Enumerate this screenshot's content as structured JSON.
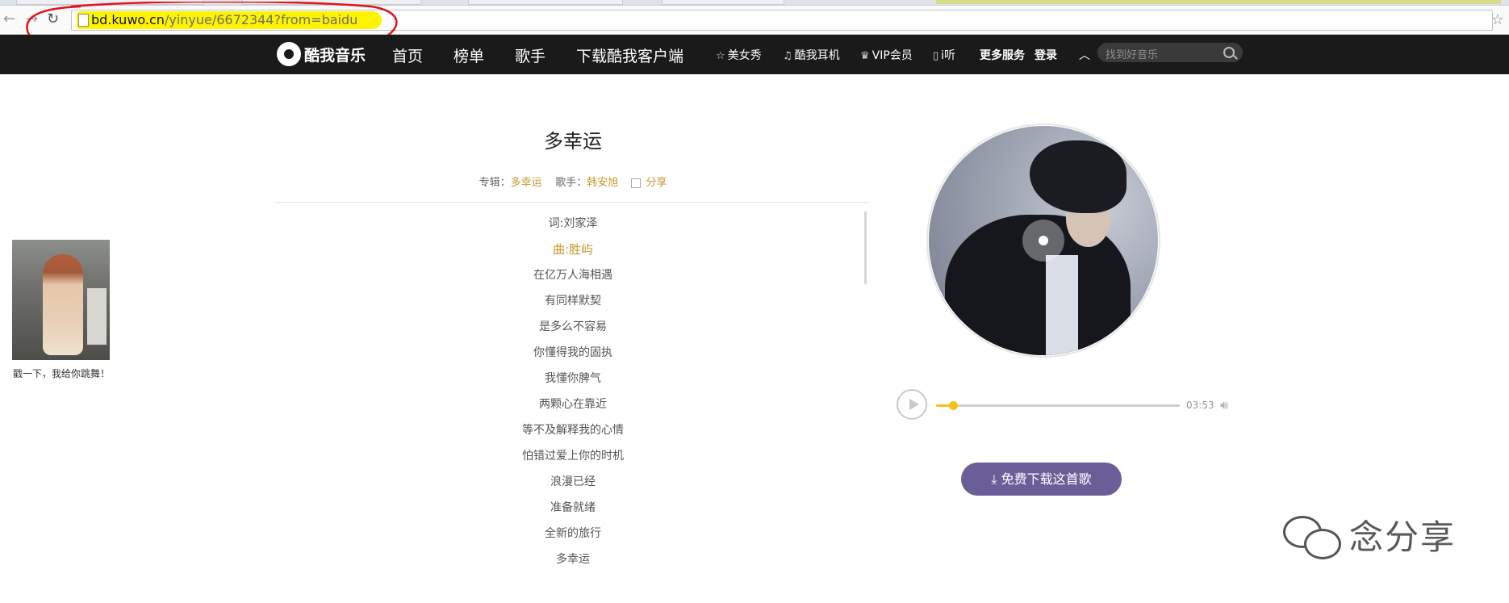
{
  "browser": {
    "url_host": "bd.kuwo.cn",
    "url_rest": "/yinyue/6672344?from=baidu"
  },
  "header": {
    "logo_text": "酷我音乐",
    "main_nav": [
      "首页",
      "榜单",
      "歌手",
      "下载酷我客户端"
    ],
    "sub_nav": [
      {
        "icon": "star-icon",
        "label": "美女秀"
      },
      {
        "icon": "headphones-icon",
        "label": "酷我耳机"
      },
      {
        "icon": "crown-icon",
        "label": "VIP会员"
      },
      {
        "icon": "book-icon",
        "label": "i听"
      }
    ],
    "more_services": "更多服务",
    "login": "登录",
    "search_placeholder": "找到好音乐"
  },
  "song": {
    "title": "多幸运",
    "album_label": "专辑：",
    "album": "多幸运",
    "artist_label": "歌手：",
    "artist": "韩安旭",
    "share": "分享"
  },
  "lyrics": [
    "词:刘家泽",
    "曲:胜屿",
    "在亿万人海相遇",
    "有同样默契",
    "是多么不容易",
    "你懂得我的固执",
    "我懂你脾气",
    "两颗心在靠近",
    "等不及解释我的心情",
    "怕错过爱上你的时机",
    "浪漫已经",
    "准备就绪",
    "全新的旅行",
    "多幸运"
  ],
  "active_lyric_index": 1,
  "ad": {
    "caption": "戳一下，我给你跳舞！"
  },
  "player": {
    "duration": "03:53",
    "progress_fraction": 0.07
  },
  "download_button": "免费下载这首歌",
  "watermark": "念分享",
  "colors": {
    "header_bg": "#1a1a1a",
    "gold": "#c8982f",
    "progress": "#f3c21a",
    "download_btn": "#6a5e98",
    "url_highlight": "#fff400",
    "annotation_red": "#e0141a"
  }
}
